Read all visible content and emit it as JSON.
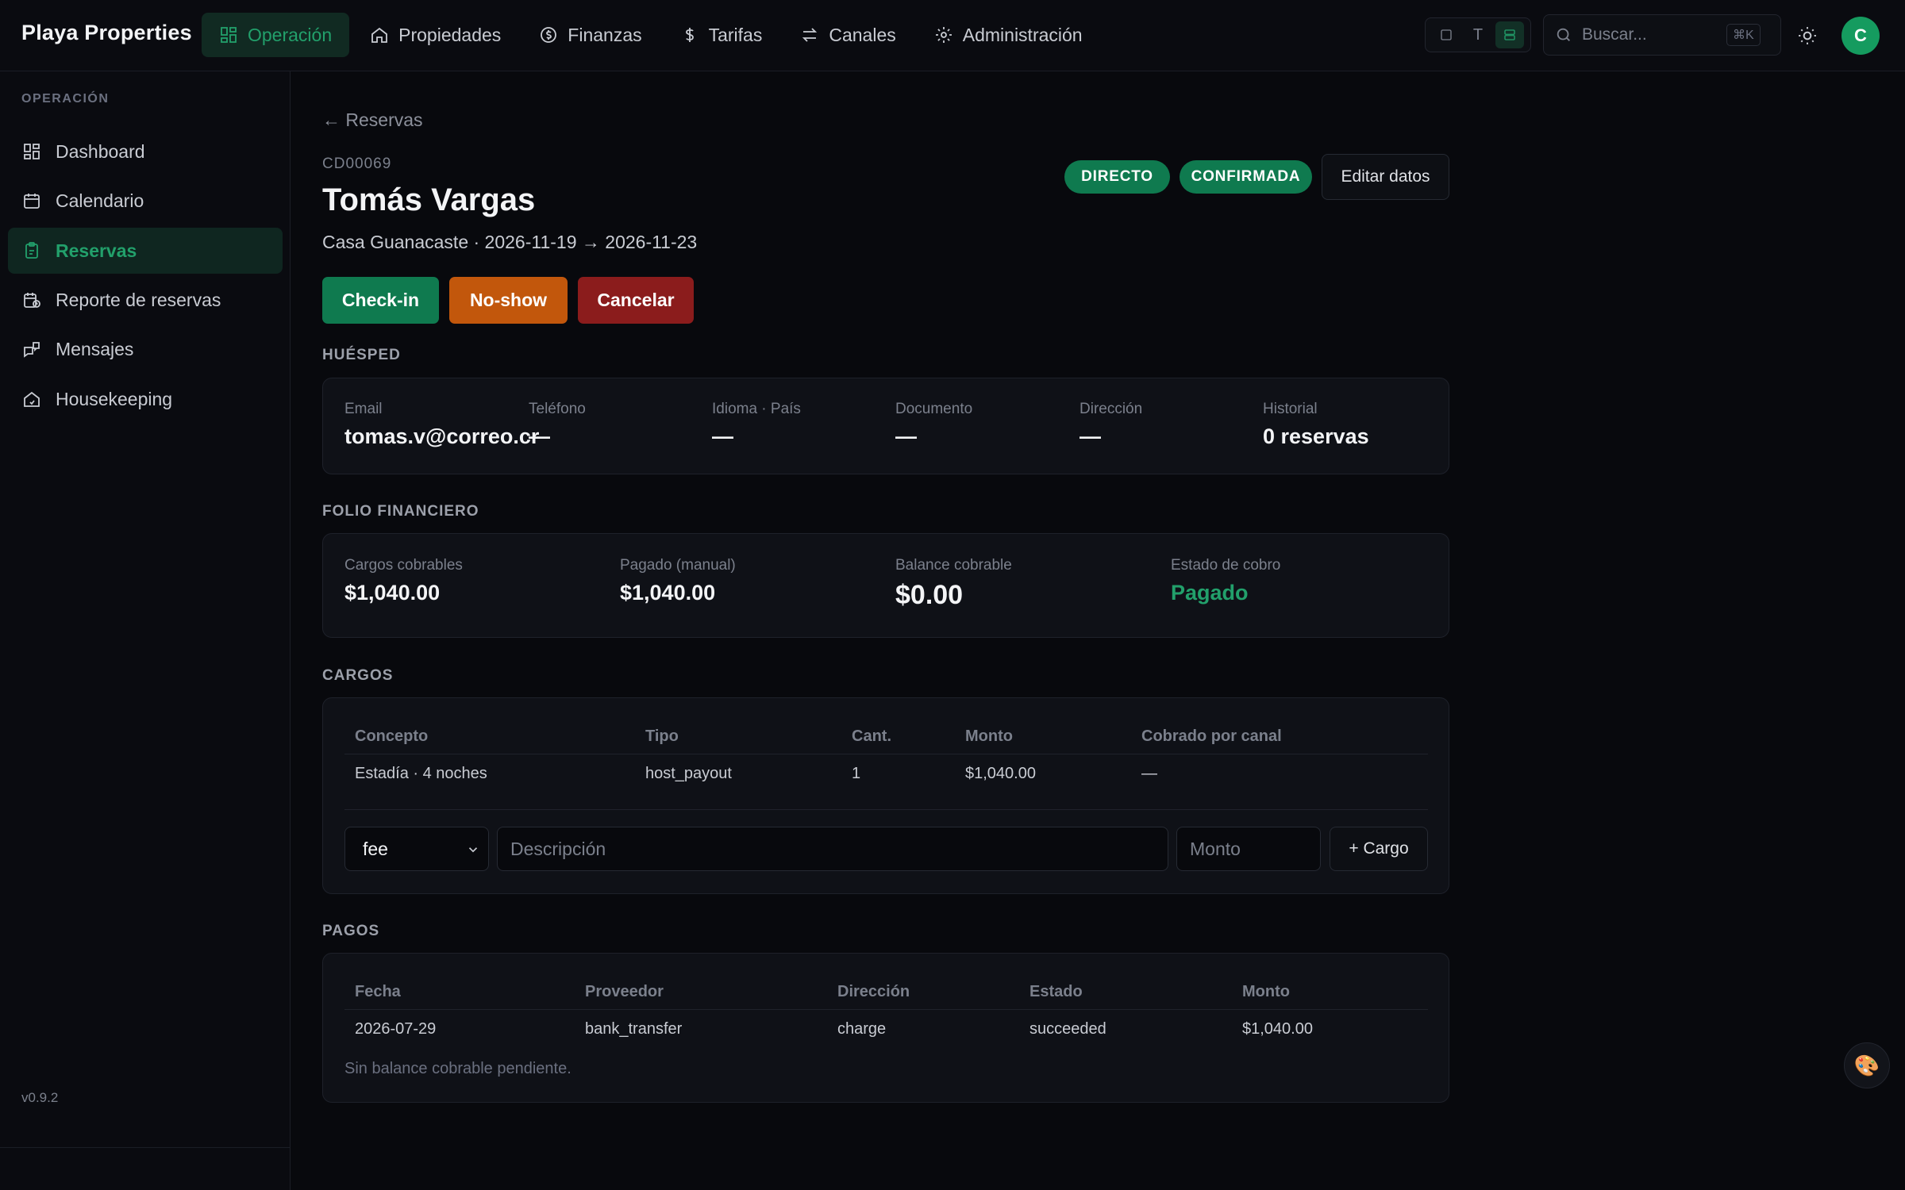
{
  "app": {
    "brand": "Playa Properties",
    "version": "v0.9.2"
  },
  "topnav": [
    {
      "label": "Operación",
      "icon": "grid-icon",
      "active": true
    },
    {
      "label": "Propiedades",
      "icon": "home-icon"
    },
    {
      "label": "Finanzas",
      "icon": "coin-icon"
    },
    {
      "label": "Tarifas",
      "icon": "dollar-icon"
    },
    {
      "label": "Canales",
      "icon": "arrows-icon"
    },
    {
      "label": "Administración",
      "icon": "gear-icon"
    }
  ],
  "viewToggle": {
    "middle": "T"
  },
  "search": {
    "placeholder": "Buscar...",
    "shortcut": "⌘K"
  },
  "user": {
    "initial": "C"
  },
  "sidebar": {
    "section": "OPERACIÓN",
    "items": [
      {
        "label": "Dashboard",
        "icon": "dashboard-icon"
      },
      {
        "label": "Calendario",
        "icon": "calendar-icon"
      },
      {
        "label": "Reservas",
        "icon": "clipboard-icon",
        "active": true
      },
      {
        "label": "Reporte de reservas",
        "icon": "calendar-report-icon"
      },
      {
        "label": "Mensajes",
        "icon": "messages-icon"
      },
      {
        "label": "Housekeeping",
        "icon": "house-clean-icon"
      }
    ]
  },
  "reservation": {
    "back": "← Reservas",
    "code": "CD00069",
    "guest": "Tomás Vargas",
    "subline": "Casa Guanacaste · 2026-11-19 → 2026-11-23",
    "badges": {
      "channel": "DIRECTO",
      "status": "CONFIRMADA"
    },
    "edit": "Editar datos",
    "actions": {
      "checkin": "Check-in",
      "noshow": "No-show",
      "cancel": "Cancelar"
    }
  },
  "colors": {
    "accent": "#22a06b",
    "checkin": "#0f7a4f",
    "noshow": "#c2570c",
    "cancel": "#8b1c1c"
  },
  "guestSection": {
    "title": "HUÉSPED",
    "fields": [
      {
        "label": "Email",
        "value": "tomas.v@correo.cr"
      },
      {
        "label": "Teléfono",
        "value": "—"
      },
      {
        "label": "Idioma · País",
        "value": "—"
      },
      {
        "label": "Documento",
        "value": "—"
      },
      {
        "label": "Dirección",
        "value": "—"
      },
      {
        "label": "Historial",
        "value": "0 reservas"
      }
    ]
  },
  "folio": {
    "title": "FOLIO FINANCIERO",
    "fields": [
      {
        "label": "Cargos cobrables",
        "value": "$1,040.00"
      },
      {
        "label": "Pagado (manual)",
        "value": "$1,040.00"
      },
      {
        "label": "Balance cobrable",
        "value": "$0.00"
      },
      {
        "label": "Estado de cobro",
        "value": "Pagado"
      }
    ]
  },
  "charges": {
    "title": "CARGOS",
    "headers": [
      "Concepto",
      "Tipo",
      "Cant.",
      "Monto",
      "Cobrado por canal"
    ],
    "rows": [
      [
        "Estadía · 4 noches",
        "host_payout",
        "1",
        "$1,040.00",
        "—"
      ]
    ],
    "form": {
      "type": "fee",
      "description_placeholder": "Descripción",
      "amount_placeholder": "Monto",
      "add": "+ Cargo"
    }
  },
  "payments": {
    "title": "PAGOS",
    "headers": [
      "Fecha",
      "Proveedor",
      "Dirección",
      "Estado",
      "Monto"
    ],
    "rows": [
      [
        "2026-07-29",
        "bank_transfer",
        "charge",
        "succeeded",
        "$1,040.00"
      ]
    ],
    "note": "Sin balance cobrable pendiente."
  }
}
